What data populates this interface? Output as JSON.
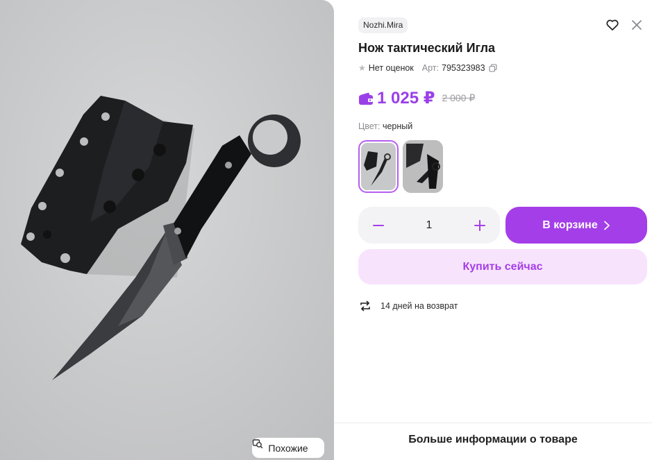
{
  "product": {
    "brand": "Nozhi.Mira",
    "title": "Нож тактический Игла",
    "rating_text": "Нет оценок",
    "article_label": "Арт:",
    "article_value": "795323983",
    "price": "1 025 ₽",
    "old_price": "2 000 ₽",
    "color_label": "Цвет:",
    "color_value": "черный",
    "quantity": "1"
  },
  "actions": {
    "cart_label": "В корзине",
    "buy_now_label": "Купить сейчас",
    "similar_label": "Похожие",
    "more_info_label": "Больше информации о товаре"
  },
  "delivery": {
    "return_text": "14 дней на возврат"
  },
  "icons": {
    "favorite": "heart-icon",
    "close": "close-icon",
    "star": "star-icon",
    "copy": "copy-icon",
    "wallet": "wallet-icon",
    "minus": "minus-icon",
    "plus": "plus-icon",
    "chevron": "chevron-right-icon",
    "return": "return-arrows-icon",
    "similar": "similar-search-icon"
  },
  "colors": {
    "accent": "#a43ee8",
    "price": "#9b3fe8",
    "buy_bg": "#f7e4fc",
    "image_bg": "#c9cacb"
  }
}
